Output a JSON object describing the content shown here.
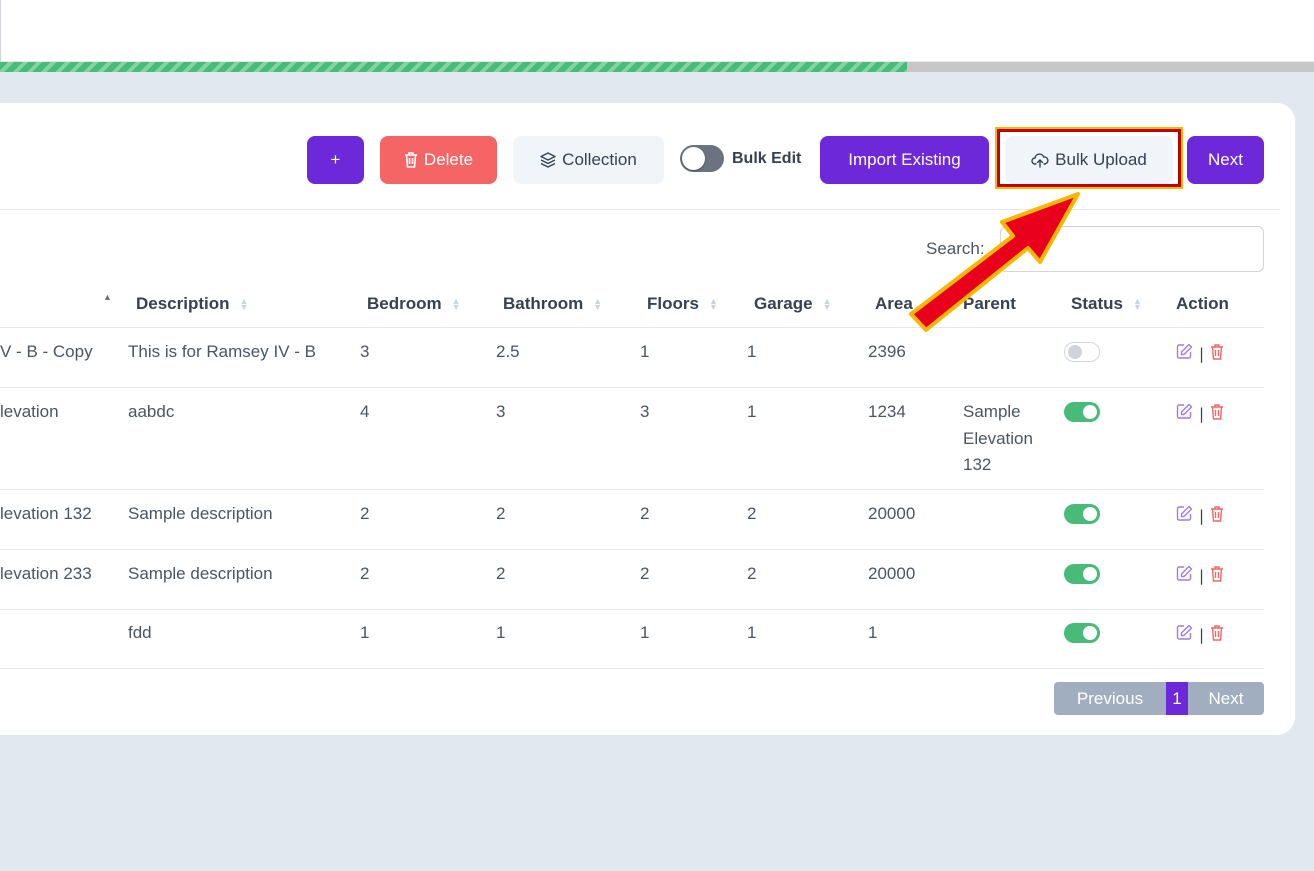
{
  "toolbar": {
    "add_label": "+",
    "delete_label": "Delete",
    "collection_label": "Collection",
    "bulk_edit_label": "Bulk Edit",
    "import_label": "Import Existing",
    "bulk_upload_label": "Bulk Upload",
    "next_label": "Next"
  },
  "progress": {
    "fraction": 0.69
  },
  "search": {
    "label": "Search:",
    "value": ""
  },
  "table": {
    "columns": [
      "Description",
      "Bedroom",
      "Bathroom",
      "Floors",
      "Garage",
      "Area",
      "Parent",
      "Status",
      "Action"
    ],
    "rows": [
      {
        "name": "V - B - Copy",
        "description": "This is for Ramsey IV - B",
        "bedroom": "3",
        "bathroom": "2.5",
        "floors": "1",
        "garage": "1",
        "area": "2396",
        "parent": "",
        "status": "off"
      },
      {
        "name": "levation",
        "description": "aabdc",
        "bedroom": "4",
        "bathroom": "3",
        "floors": "3",
        "garage": "1",
        "area": "1234",
        "parent": "Sample Elevation 132",
        "status": "on"
      },
      {
        "name": "levation 132",
        "description": "Sample description",
        "bedroom": "2",
        "bathroom": "2",
        "floors": "2",
        "garage": "2",
        "area": "20000",
        "parent": "",
        "status": "on"
      },
      {
        "name": "levation 233",
        "description": "Sample description",
        "bedroom": "2",
        "bathroom": "2",
        "floors": "2",
        "garage": "2",
        "area": "20000",
        "parent": "",
        "status": "on"
      },
      {
        "name": "",
        "description": "fdd",
        "bedroom": "1",
        "bathroom": "1",
        "floors": "1",
        "garage": "1",
        "area": "1",
        "parent": "",
        "status": "on"
      }
    ]
  },
  "pagination": {
    "previous": "Previous",
    "current": "1",
    "next": "Next"
  },
  "colors": {
    "primary": "#6d28d9",
    "danger": "#f56565",
    "success": "#48bb78",
    "highlight": "#c00000",
    "arrow": "#e8001c"
  }
}
